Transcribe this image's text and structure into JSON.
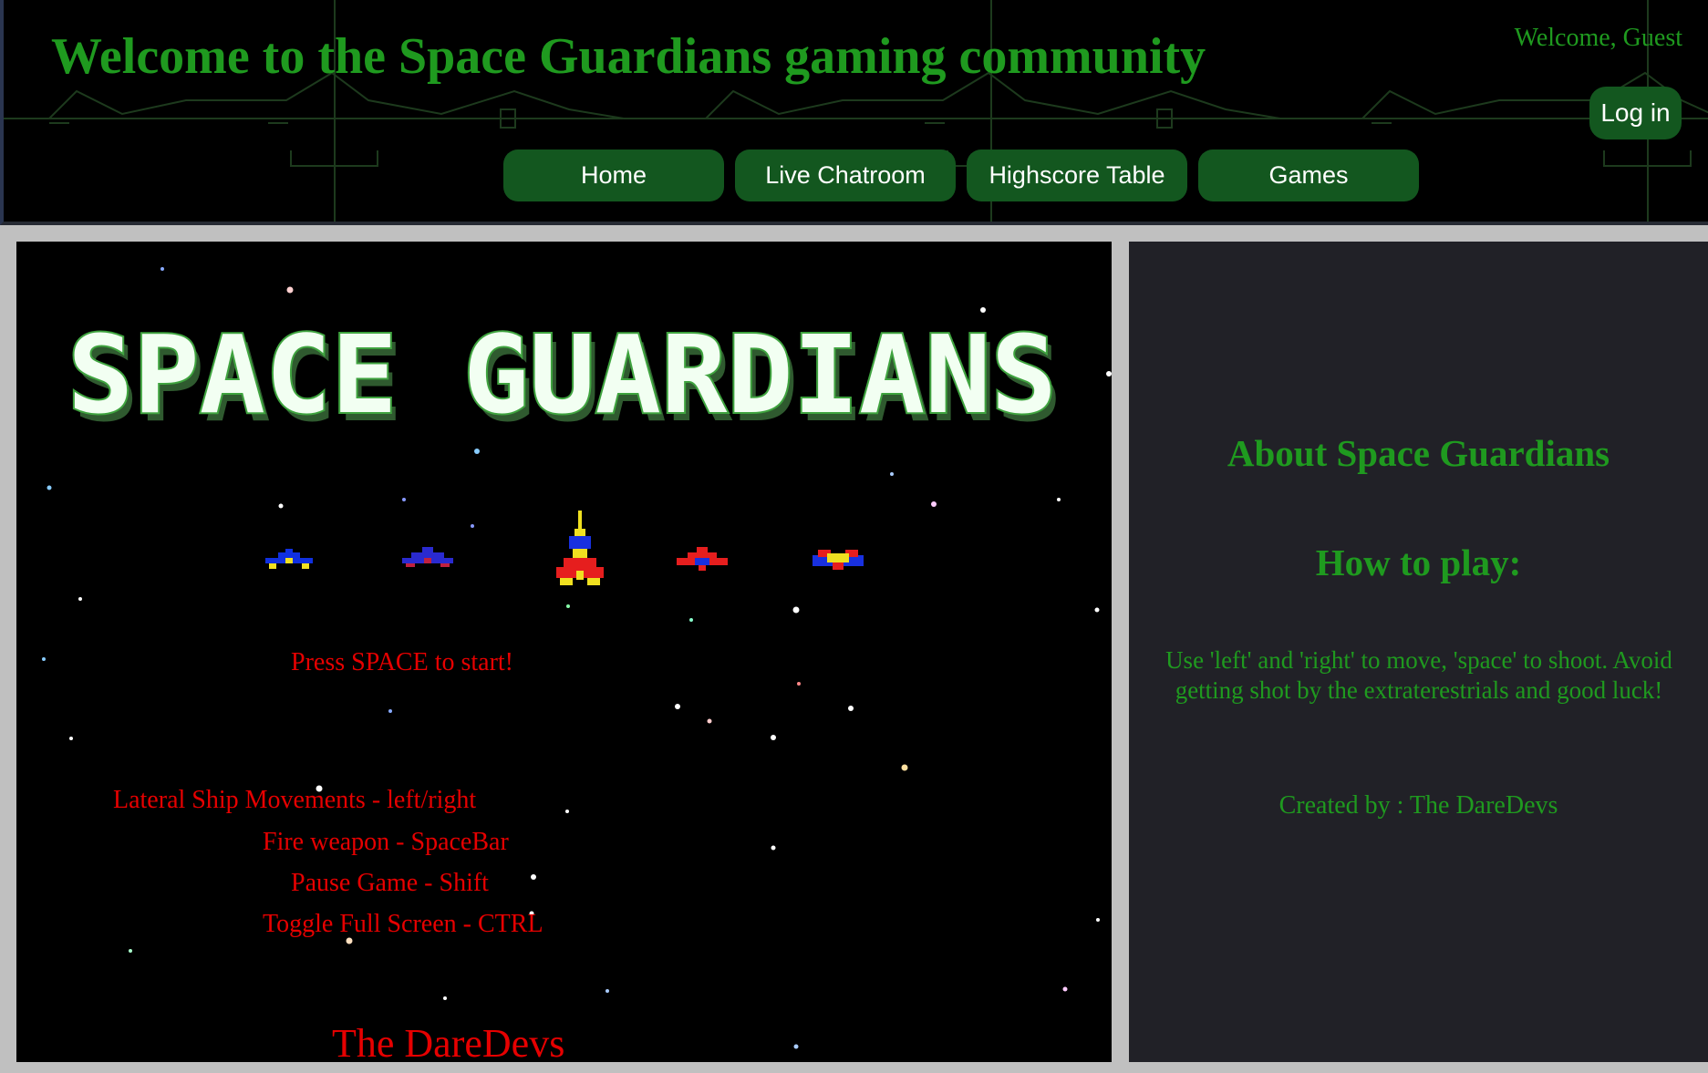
{
  "header": {
    "title": "Welcome to the Space Guardians gaming community",
    "welcome": "Welcome, Guest",
    "login_label": "Log in",
    "nav": [
      {
        "label": "Home"
      },
      {
        "label": "Live Chatroom"
      },
      {
        "label": "Highscore Table"
      },
      {
        "label": "Games"
      }
    ]
  },
  "game": {
    "logo_text": "SPACE GUARDIANS",
    "start_prompt": "Press SPACE to start!",
    "controls": [
      "Lateral Ship Movements - left/right",
      "Fire weapon - SpaceBar",
      "Pause Game - Shift",
      "Toggle Full Screen - CTRL"
    ],
    "credits": "The DareDevs"
  },
  "about": {
    "heading": "About Space Guardians",
    "howto_heading": "How to play:",
    "howto_text": "Use 'left' and 'right' to move, 'space' to shoot. Avoid getting shot by the extraterestrials and good luck!",
    "created_by": "Created by : The DareDevs"
  },
  "colors": {
    "title_green": "#1f9a1f",
    "button_green": "#13571f",
    "game_text_red": "#e60000",
    "info_bg": "#212127"
  }
}
